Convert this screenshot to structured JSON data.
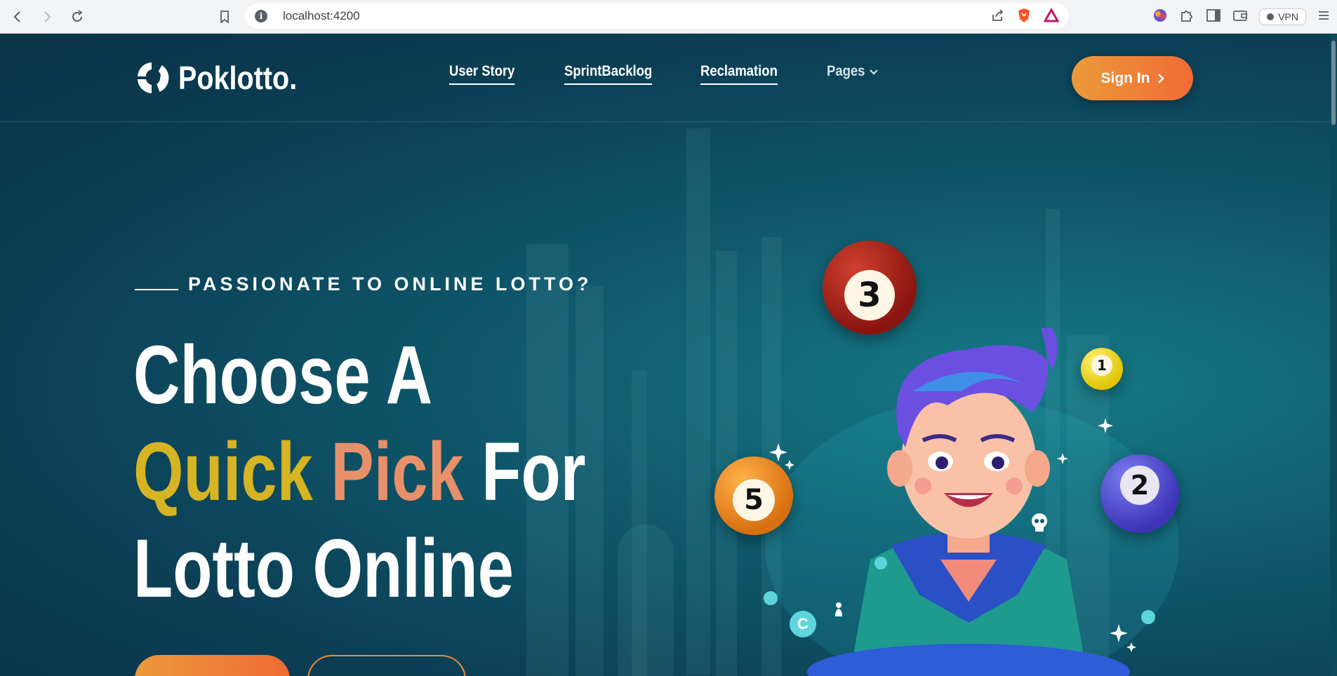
{
  "browser": {
    "url": "localhost:4200",
    "vpn_label": "VPN"
  },
  "header": {
    "logo_text": "Poklotto.",
    "nav": [
      {
        "label": "User Story"
      },
      {
        "label": "SprintBacklog"
      },
      {
        "label": "Reclamation"
      },
      {
        "label": "Pages"
      }
    ],
    "signin_label": "Sign In"
  },
  "hero": {
    "eyebrow": "PASSIONATE TO ONLINE LOTTO?",
    "line1": "Choose A",
    "quick": "Quick",
    "pick": "Pick",
    "for": "For",
    "line3": "Lotto Online"
  },
  "balls": {
    "b3": "3",
    "b1": "1",
    "b5": "5",
    "b2": "2",
    "coin": "C"
  },
  "colors": {
    "accent_orange": "#f06b35",
    "accent_gold": "#d6b424",
    "bg_teal": "#0c3f55"
  }
}
